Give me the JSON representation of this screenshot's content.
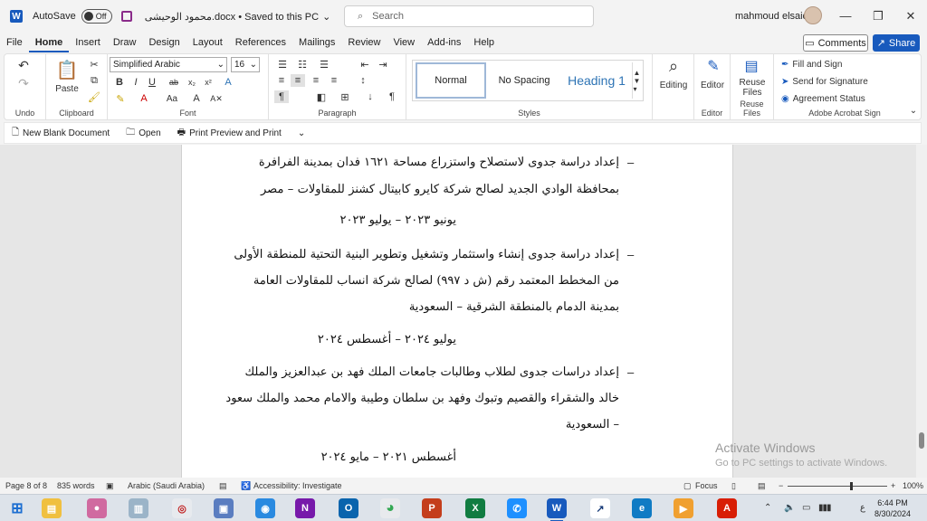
{
  "titlebar": {
    "autosave_label": "AutoSave",
    "toggle_state": "Off",
    "doc_title": "محمود الوحيشى.docx • Saved to this PC",
    "search_placeholder": "Search",
    "user_name": "mahmoud elsaid"
  },
  "tabs": [
    "File",
    "Home",
    "Insert",
    "Draw",
    "Design",
    "Layout",
    "References",
    "Mailings",
    "Review",
    "View",
    "Add-ins",
    "Help"
  ],
  "active_tab": "Home",
  "header_buttons": {
    "comments": "Comments",
    "share": "Share"
  },
  "ribbon": {
    "undo_label": "Undo",
    "clipboard": {
      "paste": "Paste",
      "label": "Clipboard"
    },
    "font": {
      "name": "Simplified Arabic",
      "size": "16",
      "label": "Font"
    },
    "paragraph": {
      "label": "Paragraph"
    },
    "styles": {
      "normal": "Normal",
      "no_spacing": "No Spacing",
      "heading1": "Heading 1",
      "label": "Styles"
    },
    "editing": {
      "label": "Editing"
    },
    "editor": {
      "button": "Editor",
      "label": "Editor"
    },
    "reuse": {
      "button": "Reuse Files",
      "label": "Reuse Files"
    },
    "acrobat": {
      "fill_sign": "Fill and Sign",
      "send_signature": "Send for Signature",
      "agreement": "Agreement Status",
      "label": "Adobe Acrobat Sign"
    }
  },
  "qat": {
    "new_blank": "New Blank Document",
    "open": "Open",
    "print_preview": "Print Preview and Print"
  },
  "document": {
    "item1": {
      "line1": "إعداد دراسة جدوى لاستصلاح واستزراع مساحة ١٦٢١ فدان بمدينة الفرافرة",
      "line2": "بمحافظة الوادي الجديد لصالح شركة كايرو كابيتال كشنز للمقاولات – مصر",
      "date": "يونيو ٢٠٢٣ – يوليو ٢٠٢٣"
    },
    "item2": {
      "line1": "إعداد دراسة جدوى إنشاء واستثمار وتشغيل وتطوير البنية التحتية للمنطقة الأولى",
      "line2": "من المخطط المعتمد رقم (ش د ٩٩٧) لصالح شركة انساب للمقاولات العامة",
      "line3": "بمدينة الدمام بالمنطقة الشرقية – السعودية",
      "date": "يوليو ٢٠٢٤ – أغسطس ٢٠٢٤"
    },
    "item3": {
      "line1": "إعداد دراسات جدوى لطلاب وطالبات جامعات الملك فهد بن عبدالعزيز والملك",
      "line2": "خالد والشقراء والقصيم وتبوك وفهد بن سلطان وطيبة والامام محمد والملك سعود",
      "line3": "– السعودية",
      "date": "أغسطس ٢٠٢١ – مايو ٢٠٢٤"
    },
    "bullet": "–"
  },
  "watermark": {
    "line1": "Activate Windows",
    "line2": "Go to PC settings to activate Windows."
  },
  "statusbar": {
    "page": "Page 8 of 8",
    "words": "835 words",
    "language": "Arabic (Saudi Arabia)",
    "accessibility": "Accessibility: Investigate",
    "focus": "Focus",
    "zoom": "100%"
  },
  "taskbar": {
    "lang": "ع",
    "time": "6:44 PM",
    "date": "8/30/2024",
    "apps": [
      "windows-start",
      "file-explorer",
      "app-2",
      "app-3",
      "file-manager",
      "app-5",
      "onenote",
      "outlook",
      "chrome",
      "powerpoint",
      "excel",
      "app-whatsapp",
      "word",
      "app-stock",
      "edge",
      "app-media",
      "acrobat"
    ]
  },
  "colors": {
    "accent": "#185abd",
    "ribbon_bg": "#ffffff",
    "window_bg": "#f3f3f3"
  }
}
